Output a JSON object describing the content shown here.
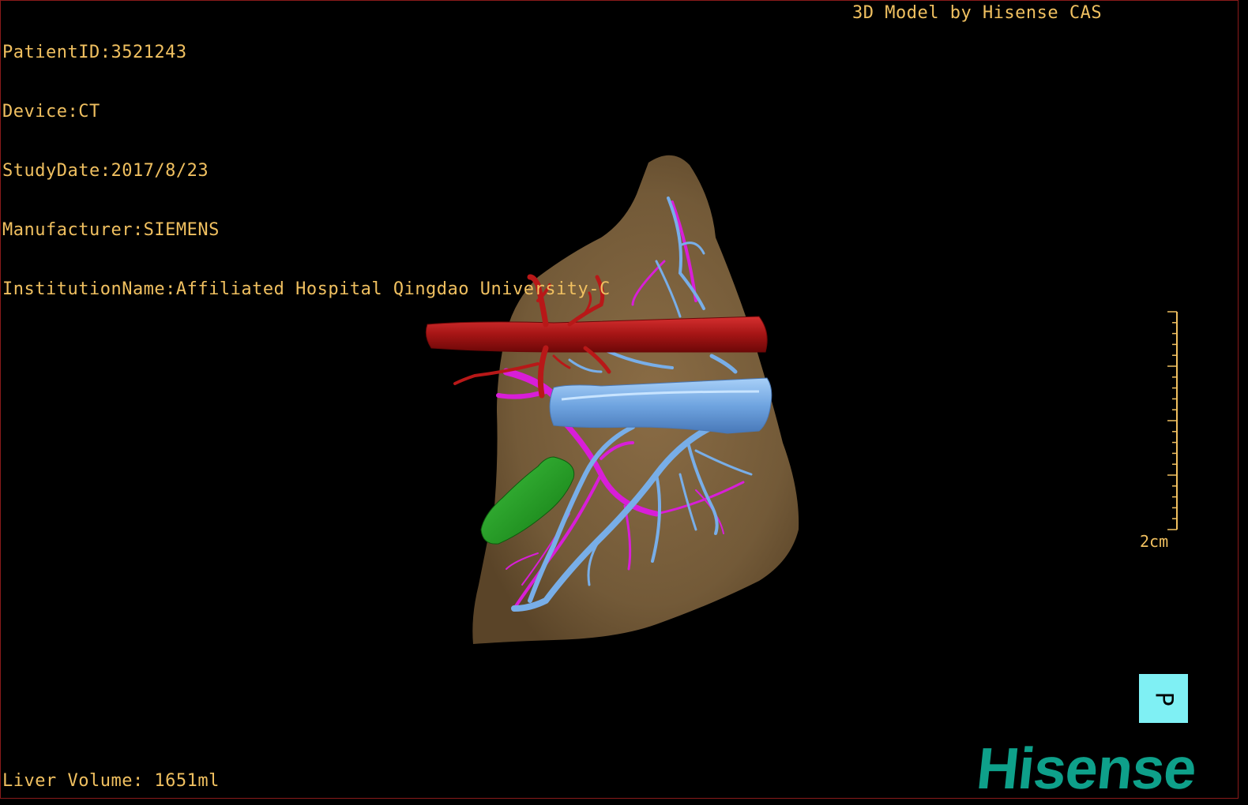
{
  "info": {
    "patient_id": "PatientID:3521243",
    "device": "Device:CT",
    "study_date": "StudyDate:2017/8/23",
    "manufacturer": "Manufacturer:SIEMENS",
    "institution": "InstitutionName:Affiliated Hospital Qingdao University-C"
  },
  "header": {
    "credit": "3D Model by Hisense CAS"
  },
  "footer": {
    "volume": "Liver Volume: 1651ml"
  },
  "scale": {
    "label": "2cm"
  },
  "orientation": {
    "label": "P",
    "icon": "orientation-cube-icon"
  },
  "logo": {
    "text": "Hisense"
  },
  "colors": {
    "overlay_text": "#f0c060",
    "liver": "#7a5f3c",
    "artery": "#b01818",
    "portal_vein": "#78aee8",
    "hepatic_vein": "#d81ed8",
    "lesion": "#1e9a1e",
    "orientation_cube": "#7ff0f4",
    "logo": "#0ea08a"
  }
}
